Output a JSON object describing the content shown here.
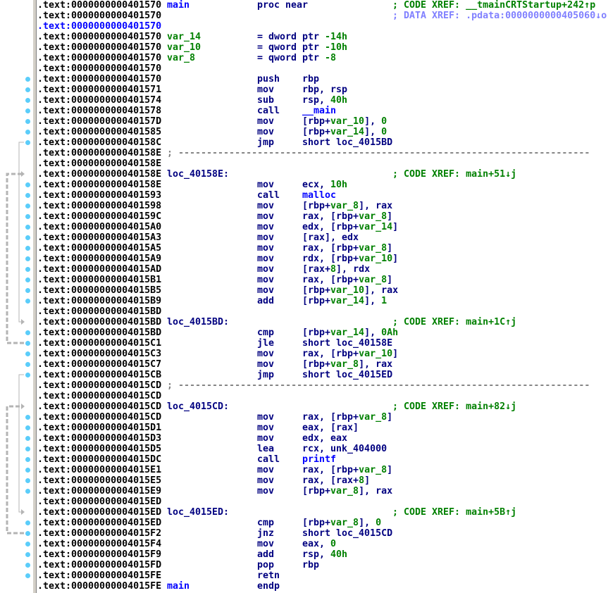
{
  "segment": ".text",
  "colors": {
    "address": "#000000",
    "highlight_address": "#0000ff",
    "mnemonic": "#000080",
    "variable": "#008000",
    "comment": "#008000",
    "data_xref": "#8080ff",
    "bullet": "#5bcdfa"
  },
  "lines": [
    {
      "addr": "0000000000401570",
      "label": "main",
      "label_kind": "fn",
      "mn": "proc near",
      "comment": "; CODE XREF: __tmainCRTStartup+242↑p"
    },
    {
      "addr": "0000000000401570",
      "comment": "; DATA XREF: .pdata:0000000000405060↓o",
      "comment_kind": "data"
    },
    {
      "addr": "0000000000401570",
      "highlight": true
    },
    {
      "addr": "0000000000401570",
      "label": "var_14",
      "label_kind": "var",
      "mn": "= dword ptr",
      "ops": [
        {
          "t": " -14h",
          "c": "g"
        }
      ]
    },
    {
      "addr": "0000000000401570",
      "label": "var_10",
      "label_kind": "var",
      "mn": "= qword ptr",
      "ops": [
        {
          "t": " -10h",
          "c": "g"
        }
      ]
    },
    {
      "addr": "0000000000401570",
      "label": "var_8",
      "label_kind": "var",
      "mn": "= qword ptr",
      "ops": [
        {
          "t": " -8",
          "c": "g"
        }
      ]
    },
    {
      "addr": "0000000000401570"
    },
    {
      "addr": "0000000000401570",
      "ins": true,
      "mn": "push",
      "ops": [
        {
          "t": "rbp"
        }
      ]
    },
    {
      "addr": "0000000000401571",
      "ins": true,
      "mn": "mov",
      "ops": [
        {
          "t": "rbp, rsp"
        }
      ]
    },
    {
      "addr": "0000000000401574",
      "ins": true,
      "mn": "sub",
      "ops": [
        {
          "t": "rsp, "
        },
        {
          "t": "40h",
          "c": "g"
        }
      ]
    },
    {
      "addr": "0000000000401578",
      "ins": true,
      "mn": "call",
      "ops": [
        {
          "t": "__main",
          "c": "b"
        }
      ]
    },
    {
      "addr": "000000000040157D",
      "ins": true,
      "mn": "mov",
      "ops": [
        {
          "t": "[rbp+"
        },
        {
          "t": "var_10",
          "c": "g"
        },
        {
          "t": "], "
        },
        {
          "t": "0",
          "c": "g"
        }
      ]
    },
    {
      "addr": "0000000000401585",
      "ins": true,
      "mn": "mov",
      "ops": [
        {
          "t": "[rbp+"
        },
        {
          "t": "var_14",
          "c": "g"
        },
        {
          "t": "], "
        },
        {
          "t": "0",
          "c": "g"
        }
      ]
    },
    {
      "addr": "000000000040158C",
      "ins": true,
      "mn": "jmp",
      "ops": [
        {
          "t": "short loc_4015BD"
        }
      ]
    },
    {
      "addr": "000000000040158E",
      "separator": "; -------------------------------------------------------------------------"
    },
    {
      "addr": "000000000040158E"
    },
    {
      "addr": "000000000040158E",
      "label": "loc_40158E:",
      "comment": "; CODE XREF: main+51↓j"
    },
    {
      "addr": "000000000040158E",
      "ins": true,
      "mn": "mov",
      "ops": [
        {
          "t": "ecx, "
        },
        {
          "t": "10h",
          "c": "g"
        }
      ]
    },
    {
      "addr": "0000000000401593",
      "ins": true,
      "mn": "call",
      "ops": [
        {
          "t": "malloc",
          "c": "b"
        }
      ]
    },
    {
      "addr": "0000000000401598",
      "ins": true,
      "mn": "mov",
      "ops": [
        {
          "t": "[rbp+"
        },
        {
          "t": "var_8",
          "c": "g"
        },
        {
          "t": "], rax"
        }
      ]
    },
    {
      "addr": "000000000040159C",
      "ins": true,
      "mn": "mov",
      "ops": [
        {
          "t": "rax, [rbp+"
        },
        {
          "t": "var_8",
          "c": "g"
        },
        {
          "t": "]"
        }
      ]
    },
    {
      "addr": "00000000004015A0",
      "ins": true,
      "mn": "mov",
      "ops": [
        {
          "t": "edx, [rbp+"
        },
        {
          "t": "var_14",
          "c": "g"
        },
        {
          "t": "]"
        }
      ]
    },
    {
      "addr": "00000000004015A3",
      "ins": true,
      "mn": "mov",
      "ops": [
        {
          "t": "[rax], edx"
        }
      ]
    },
    {
      "addr": "00000000004015A5",
      "ins": true,
      "mn": "mov",
      "ops": [
        {
          "t": "rax, [rbp+"
        },
        {
          "t": "var_8",
          "c": "g"
        },
        {
          "t": "]"
        }
      ]
    },
    {
      "addr": "00000000004015A9",
      "ins": true,
      "mn": "mov",
      "ops": [
        {
          "t": "rdx, [rbp+"
        },
        {
          "t": "var_10",
          "c": "g"
        },
        {
          "t": "]"
        }
      ]
    },
    {
      "addr": "00000000004015AD",
      "ins": true,
      "mn": "mov",
      "ops": [
        {
          "t": "[rax+"
        },
        {
          "t": "8",
          "c": "g"
        },
        {
          "t": "], rdx"
        }
      ]
    },
    {
      "addr": "00000000004015B1",
      "ins": true,
      "mn": "mov",
      "ops": [
        {
          "t": "rax, [rbp+"
        },
        {
          "t": "var_8",
          "c": "g"
        },
        {
          "t": "]"
        }
      ]
    },
    {
      "addr": "00000000004015B5",
      "ins": true,
      "mn": "mov",
      "ops": [
        {
          "t": "[rbp+"
        },
        {
          "t": "var_10",
          "c": "g"
        },
        {
          "t": "], rax"
        }
      ]
    },
    {
      "addr": "00000000004015B9",
      "ins": true,
      "mn": "add",
      "ops": [
        {
          "t": "[rbp+"
        },
        {
          "t": "var_14",
          "c": "g"
        },
        {
          "t": "], "
        },
        {
          "t": "1",
          "c": "g"
        }
      ]
    },
    {
      "addr": "00000000004015BD"
    },
    {
      "addr": "00000000004015BD",
      "label": "loc_4015BD:",
      "comment": "; CODE XREF: main+1C↑j"
    },
    {
      "addr": "00000000004015BD",
      "ins": true,
      "mn": "cmp",
      "ops": [
        {
          "t": "[rbp+"
        },
        {
          "t": "var_14",
          "c": "g"
        },
        {
          "t": "], "
        },
        {
          "t": "0Ah",
          "c": "g"
        }
      ]
    },
    {
      "addr": "00000000004015C1",
      "ins": true,
      "mn": "jle",
      "ops": [
        {
          "t": "short loc_40158E"
        }
      ]
    },
    {
      "addr": "00000000004015C3",
      "ins": true,
      "mn": "mov",
      "ops": [
        {
          "t": "rax, [rbp+"
        },
        {
          "t": "var_10",
          "c": "g"
        },
        {
          "t": "]"
        }
      ]
    },
    {
      "addr": "00000000004015C7",
      "ins": true,
      "mn": "mov",
      "ops": [
        {
          "t": "[rbp+"
        },
        {
          "t": "var_8",
          "c": "g"
        },
        {
          "t": "], rax"
        }
      ]
    },
    {
      "addr": "00000000004015CB",
      "ins": true,
      "mn": "jmp",
      "ops": [
        {
          "t": "short loc_4015ED"
        }
      ]
    },
    {
      "addr": "00000000004015CD",
      "separator": "; -------------------------------------------------------------------------"
    },
    {
      "addr": "00000000004015CD"
    },
    {
      "addr": "00000000004015CD",
      "label": "loc_4015CD:",
      "comment": "; CODE XREF: main+82↓j"
    },
    {
      "addr": "00000000004015CD",
      "ins": true,
      "mn": "mov",
      "ops": [
        {
          "t": "rax, [rbp+"
        },
        {
          "t": "var_8",
          "c": "g"
        },
        {
          "t": "]"
        }
      ]
    },
    {
      "addr": "00000000004015D1",
      "ins": true,
      "mn": "mov",
      "ops": [
        {
          "t": "eax, [rax]"
        }
      ]
    },
    {
      "addr": "00000000004015D3",
      "ins": true,
      "mn": "mov",
      "ops": [
        {
          "t": "edx, eax"
        }
      ]
    },
    {
      "addr": "00000000004015D5",
      "ins": true,
      "mn": "lea",
      "ops": [
        {
          "t": "rcx, unk_404000"
        }
      ]
    },
    {
      "addr": "00000000004015DC",
      "ins": true,
      "mn": "call",
      "ops": [
        {
          "t": "printf",
          "c": "b"
        }
      ]
    },
    {
      "addr": "00000000004015E1",
      "ins": true,
      "mn": "mov",
      "ops": [
        {
          "t": "rax, [rbp+"
        },
        {
          "t": "var_8",
          "c": "g"
        },
        {
          "t": "]"
        }
      ]
    },
    {
      "addr": "00000000004015E5",
      "ins": true,
      "mn": "mov",
      "ops": [
        {
          "t": "rax, [rax+"
        },
        {
          "t": "8",
          "c": "g"
        },
        {
          "t": "]"
        }
      ]
    },
    {
      "addr": "00000000004015E9",
      "ins": true,
      "mn": "mov",
      "ops": [
        {
          "t": "[rbp+"
        },
        {
          "t": "var_8",
          "c": "g"
        },
        {
          "t": "], rax"
        }
      ]
    },
    {
      "addr": "00000000004015ED"
    },
    {
      "addr": "00000000004015ED",
      "label": "loc_4015ED:",
      "comment": "; CODE XREF: main+5B↑j"
    },
    {
      "addr": "00000000004015ED",
      "ins": true,
      "mn": "cmp",
      "ops": [
        {
          "t": "[rbp+"
        },
        {
          "t": "var_8",
          "c": "g"
        },
        {
          "t": "], "
        },
        {
          "t": "0",
          "c": "g"
        }
      ]
    },
    {
      "addr": "00000000004015F2",
      "ins": true,
      "mn": "jnz",
      "ops": [
        {
          "t": "short loc_4015CD"
        }
      ]
    },
    {
      "addr": "00000000004015F4",
      "ins": true,
      "mn": "mov",
      "ops": [
        {
          "t": "eax, "
        },
        {
          "t": "0",
          "c": "g"
        }
      ]
    },
    {
      "addr": "00000000004015F9",
      "ins": true,
      "mn": "add",
      "ops": [
        {
          "t": "rsp, "
        },
        {
          "t": "40h",
          "c": "g"
        }
      ]
    },
    {
      "addr": "00000000004015FD",
      "ins": true,
      "mn": "pop",
      "ops": [
        {
          "t": "rbp"
        }
      ]
    },
    {
      "addr": "00000000004015FE",
      "ins": true,
      "mn": "retn"
    },
    {
      "addr": "00000000004015FE",
      "label": "main",
      "label_kind": "fn",
      "mn": "endp"
    }
  ],
  "jump_arrows": [
    {
      "from_line": 13,
      "to_line": 30,
      "style": "solid"
    },
    {
      "from_line": 32,
      "to_line": 16,
      "style": "dashed"
    },
    {
      "from_line": 35,
      "to_line": 48,
      "style": "solid"
    },
    {
      "from_line": 50,
      "to_line": 38,
      "style": "dashed"
    }
  ]
}
